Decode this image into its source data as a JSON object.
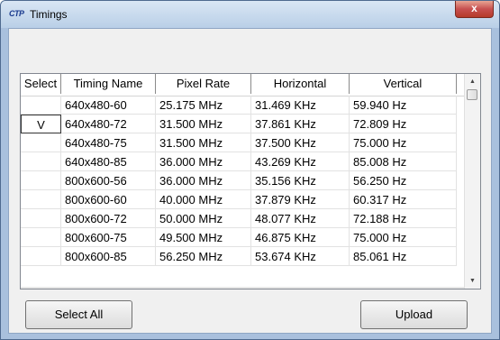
{
  "window": {
    "title": "Timings",
    "app_icon": "CTP",
    "close_glyph": "x"
  },
  "table": {
    "columns": [
      "Select",
      "Timing Name",
      "Pixel Rate",
      "Horizontal",
      "Vertical"
    ],
    "rows": [
      {
        "select": "",
        "name": "640x480-60",
        "pixel_rate": "25.175 MHz",
        "horizontal": "31.469 KHz",
        "vertical": "59.940 Hz"
      },
      {
        "select": "V",
        "name": "640x480-72",
        "pixel_rate": "31.500 MHz",
        "horizontal": "37.861 KHz",
        "vertical": "72.809 Hz"
      },
      {
        "select": "",
        "name": "640x480-75",
        "pixel_rate": "31.500 MHz",
        "horizontal": "37.500 KHz",
        "vertical": "75.000 Hz"
      },
      {
        "select": "",
        "name": "640x480-85",
        "pixel_rate": "36.000 MHz",
        "horizontal": "43.269 KHz",
        "vertical": "85.008 Hz"
      },
      {
        "select": "",
        "name": "800x600-56",
        "pixel_rate": "36.000 MHz",
        "horizontal": "35.156 KHz",
        "vertical": "56.250 Hz"
      },
      {
        "select": "",
        "name": "800x600-60",
        "pixel_rate": "40.000 MHz",
        "horizontal": "37.879 KHz",
        "vertical": "60.317 Hz"
      },
      {
        "select": "",
        "name": "800x600-72",
        "pixel_rate": "50.000 MHz",
        "horizontal": "48.077 KHz",
        "vertical": "72.188 Hz"
      },
      {
        "select": "",
        "name": "800x600-75",
        "pixel_rate": "49.500 MHz",
        "horizontal": "46.875 KHz",
        "vertical": "75.000 Hz"
      },
      {
        "select": "",
        "name": "800x600-85",
        "pixel_rate": "56.250 MHz",
        "horizontal": "53.674 KHz",
        "vertical": "85.061 Hz"
      }
    ]
  },
  "buttons": {
    "select_all": "Select All",
    "upload": "Upload"
  },
  "scrollbar": {
    "up_arrow": "▲",
    "down_arrow": "▼"
  }
}
